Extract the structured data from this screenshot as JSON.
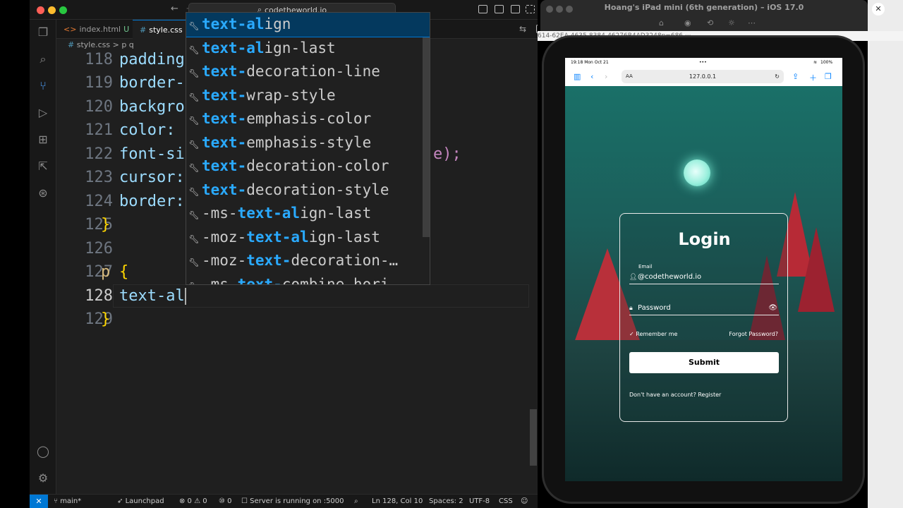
{
  "window": {
    "command_center": "codetheworld.io"
  },
  "tabs": [
    {
      "label": "index.html",
      "badge": "U"
    },
    {
      "label": "style.css"
    }
  ],
  "breadcrumb": {
    "file": "style.css",
    "separator": ">",
    "selector": "p q"
  },
  "editor": {
    "lines": [
      {
        "num": "118",
        "text": "padding"
      },
      {
        "num": "119",
        "text": "border-"
      },
      {
        "num": "120",
        "text": "backgro"
      },
      {
        "num": "121",
        "text": "color:"
      },
      {
        "num": "122",
        "text": "font-si",
        "tail": "e);"
      },
      {
        "num": "123",
        "text": "cursor:"
      },
      {
        "num": "124",
        "text": "border:"
      },
      {
        "num": "125",
        "text": "}"
      },
      {
        "num": "126",
        "text": ""
      },
      {
        "num": "127",
        "text": "p",
        "brace": "{"
      },
      {
        "num": "128",
        "text": "text-al"
      },
      {
        "num": "129",
        "text": "}"
      }
    ]
  },
  "suggestions": [
    {
      "prefix": "",
      "hl1": "text-al",
      "rest": "ign"
    },
    {
      "prefix": "",
      "hl1": "text-al",
      "rest": "ign-last"
    },
    {
      "prefix": "",
      "hl1": "text-",
      "rest": "decoration-line"
    },
    {
      "prefix": "",
      "hl1": "text-",
      "rest": "wrap-style"
    },
    {
      "prefix": "",
      "hl1": "text-",
      "rest": "emphasis-color"
    },
    {
      "prefix": "",
      "hl1": "text-",
      "rest": "emphasis-style"
    },
    {
      "prefix": "",
      "hl1": "text-",
      "rest": "decoration-color"
    },
    {
      "prefix": "",
      "hl1": "text-",
      "rest": "decoration-style"
    },
    {
      "prefix": "-ms-",
      "hl1": "text-al",
      "rest": "ign-last"
    },
    {
      "prefix": "-moz-",
      "hl1": "text-al",
      "rest": "ign-last"
    },
    {
      "prefix": "-moz-",
      "hl1": "text-",
      "rest": "decoration-…"
    },
    {
      "prefix": "-ms-",
      "hl1": "text-",
      "rest": "combine-hori"
    }
  ],
  "statusbar": {
    "branch": "main*",
    "launchpad": "Launchpad",
    "problems": "⊗ 0 ⚠ 0",
    "ports": "⑩ 0",
    "server": "Server is running on :5000",
    "position": "Ln 128, Col 10",
    "spaces": "Spaces: 2",
    "encoding": "UTF-8",
    "language": "CSS"
  },
  "simulator": {
    "title": "Hoang's iPad mini (6th generation) – iOS 17.0",
    "strip": "614-62EA-4635-8384-46276B4AD3248p=686   ··· ",
    "status_time": "19:18  Mon Oct 21",
    "battery": "100%",
    "url": "127.0.0.1",
    "aa": "AA"
  },
  "login": {
    "title": "Login",
    "email_label": "Email",
    "email_value": "@codetheworld.io",
    "password_placeholder": "Password",
    "remember": "Remember me",
    "forgot": "Forgot Password?",
    "submit": "Submit",
    "register": "Don't have an account? Register"
  },
  "colors": {
    "accent": "#0078d4",
    "highlight": "#2aaaff"
  }
}
